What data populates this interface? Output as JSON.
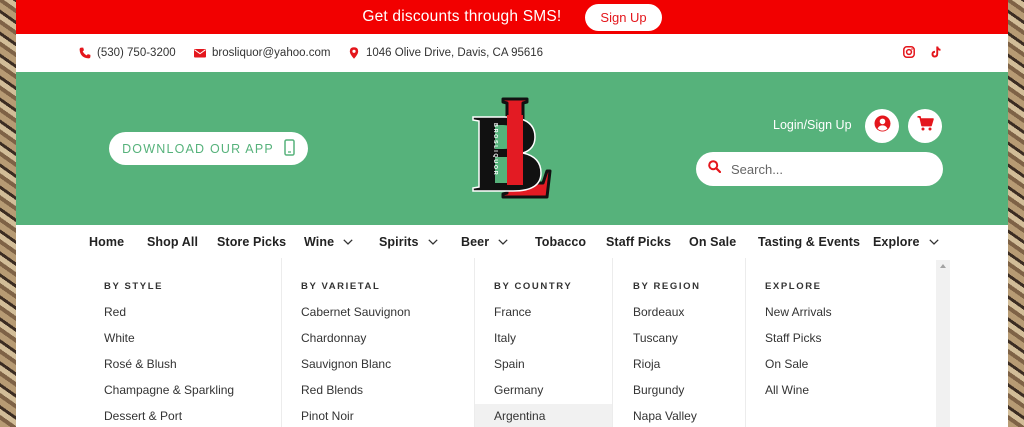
{
  "colors": {
    "promo_bg": "#f20000",
    "header_bg": "#56b27b",
    "accent_red": "#e4161c"
  },
  "promo": {
    "text": "Get discounts through SMS!",
    "button": "Sign Up"
  },
  "contact": {
    "phone": "(530) 750-3200",
    "email": "brosliquor@yahoo.com",
    "address": "1046 Olive Drive, Davis, CA 95616",
    "social": [
      "instagram-icon",
      "tiktok-icon"
    ]
  },
  "header": {
    "app_button": "DOWNLOAD OUR APP",
    "logo_letters": "BL",
    "logo_word": "BROSLIQUOR",
    "login": "Login/Sign Up",
    "search_placeholder": "Search..."
  },
  "nav": [
    {
      "label": "Home",
      "dropdown": false
    },
    {
      "label": "Shop All",
      "dropdown": false
    },
    {
      "label": "Store Picks",
      "dropdown": false
    },
    {
      "label": "Wine",
      "dropdown": true
    },
    {
      "label": "Spirits",
      "dropdown": true
    },
    {
      "label": "Beer",
      "dropdown": true
    },
    {
      "label": "Tobacco",
      "dropdown": false
    },
    {
      "label": "Staff Picks",
      "dropdown": false
    },
    {
      "label": "On Sale",
      "dropdown": false
    },
    {
      "label": "Tasting & Events",
      "dropdown": false
    },
    {
      "label": "Explore",
      "dropdown": true
    }
  ],
  "mega_menu": {
    "by_style": {
      "title": "BY STYLE",
      "items": [
        "Red",
        "White",
        "Rosé & Blush",
        "Champagne & Sparkling",
        "Dessert & Port"
      ]
    },
    "by_varietal": {
      "title": "BY VARIETAL",
      "items": [
        "Cabernet Sauvignon",
        "Chardonnay",
        "Sauvignon Blanc",
        "Red Blends",
        "Pinot Noir"
      ]
    },
    "by_country": {
      "title": "BY COUNTRY",
      "items": [
        "France",
        "Italy",
        "Spain",
        "Germany",
        "Argentina"
      ]
    },
    "by_region": {
      "title": "BY REGION",
      "items": [
        "Bordeaux",
        "Tuscany",
        "Rioja",
        "Burgundy",
        "Napa Valley"
      ]
    },
    "explore": {
      "title": "EXPLORE",
      "items": [
        "New Arrivals",
        "Staff Picks",
        "On Sale",
        "All Wine"
      ]
    }
  }
}
